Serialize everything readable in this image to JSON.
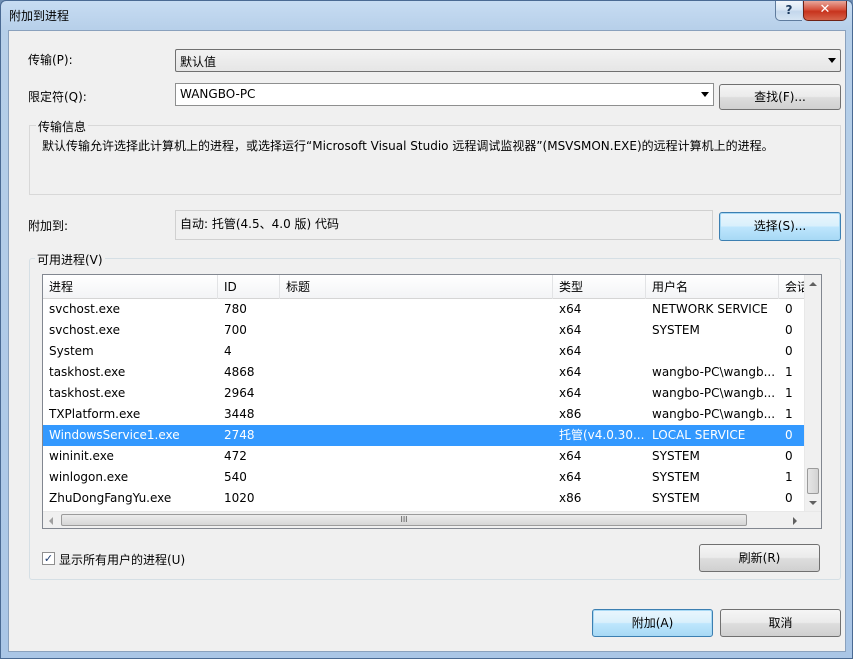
{
  "window": {
    "title": "附加到进程",
    "help_label": "?",
    "close_label": "✕"
  },
  "transport": {
    "label": "传输(P):",
    "value": "默认值"
  },
  "qualifier": {
    "label": "限定符(Q):",
    "value": "WANGBO-PC",
    "find_button": "查找(F)..."
  },
  "transport_info": {
    "title": "传输信息",
    "text": "默认传输允许选择此计算机上的进程，或选择运行“Microsoft Visual Studio 远程调试监视器”(MSVSMON.EXE)的远程计算机上的进程。"
  },
  "attach_to": {
    "label": "附加到:",
    "value": "自动: 托管(4.5、4.0 版) 代码",
    "select_button": "选择(S)..."
  },
  "available": {
    "title": "可用进程(V)",
    "columns": [
      "进程",
      "ID",
      "标题",
      "类型",
      "用户名",
      "会话"
    ],
    "rows": [
      {
        "process": "svchost.exe",
        "id": "780",
        "title": "",
        "type": "x64",
        "user": "NETWORK SERVICE",
        "session": "0"
      },
      {
        "process": "svchost.exe",
        "id": "700",
        "title": "",
        "type": "x64",
        "user": "SYSTEM",
        "session": "0"
      },
      {
        "process": "System",
        "id": "4",
        "title": "",
        "type": "x64",
        "user": "",
        "session": "0"
      },
      {
        "process": "taskhost.exe",
        "id": "4868",
        "title": "",
        "type": "x64",
        "user": "wangbo-PC\\wangb...",
        "session": "1"
      },
      {
        "process": "taskhost.exe",
        "id": "2964",
        "title": "",
        "type": "x64",
        "user": "wangbo-PC\\wangb...",
        "session": "1"
      },
      {
        "process": "TXPlatform.exe",
        "id": "3448",
        "title": "",
        "type": "x86",
        "user": "wangbo-PC\\wangb...",
        "session": "1"
      },
      {
        "process": "WindowsService1.exe",
        "id": "2748",
        "title": "",
        "type": "托管(v4.0.30...",
        "user": "LOCAL SERVICE",
        "session": "0",
        "selected": true
      },
      {
        "process": "wininit.exe",
        "id": "472",
        "title": "",
        "type": "x64",
        "user": "SYSTEM",
        "session": "0"
      },
      {
        "process": "winlogon.exe",
        "id": "540",
        "title": "",
        "type": "x64",
        "user": "SYSTEM",
        "session": "1"
      },
      {
        "process": "ZhuDongFangYu.exe",
        "id": "1020",
        "title": "",
        "type": "x86",
        "user": "SYSTEM",
        "session": "0"
      }
    ],
    "hscroll_grip": "III"
  },
  "show_all_users": {
    "label": "显示所有用户的进程(U)",
    "checked": true,
    "check_mark": "✓"
  },
  "refresh_button": "刷新(R)",
  "attach_button": "附加(A)",
  "cancel_button": "取消"
}
